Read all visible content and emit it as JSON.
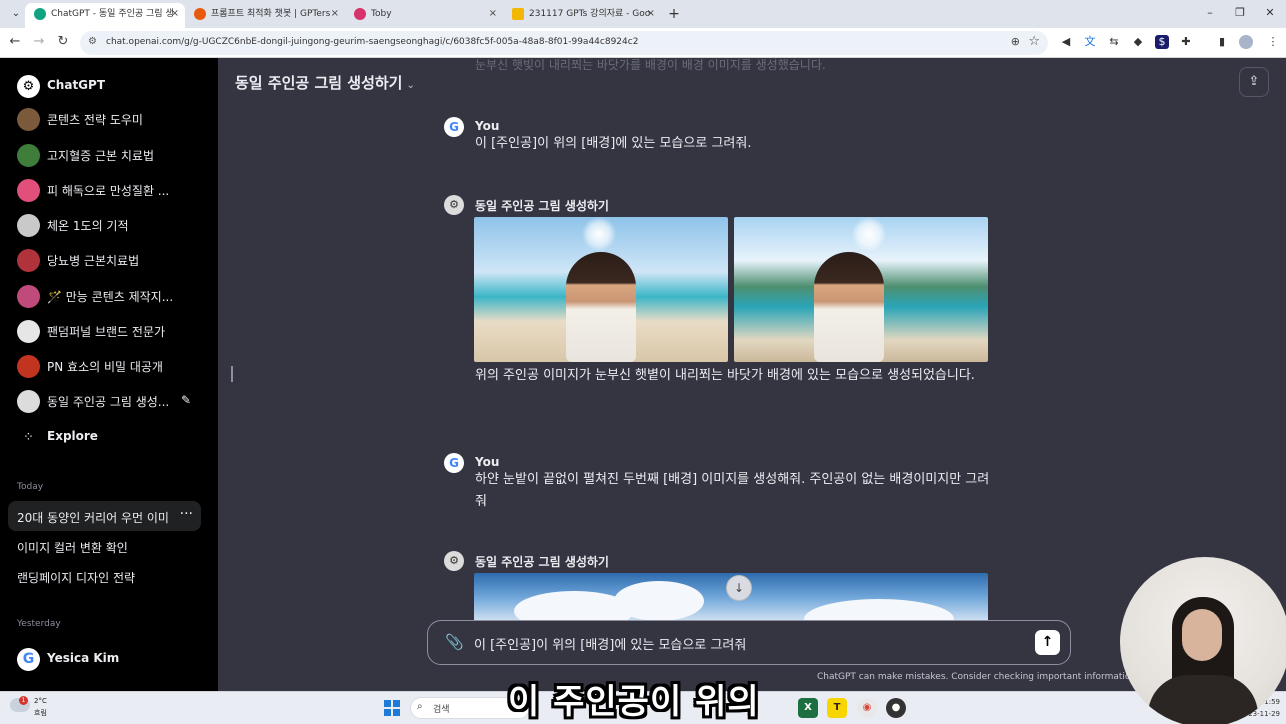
{
  "browser": {
    "tabs": [
      {
        "title": "ChatGPT - 동일 주인공 그림 생",
        "active": true,
        "favicon_color": "#10a37f"
      },
      {
        "title": "프롬프트 최적화 챗봇 | GPTers",
        "active": false,
        "favicon_color": "#e8590c"
      },
      {
        "title": "Toby",
        "active": false,
        "favicon_color": "#d6336c"
      },
      {
        "title": "231117 GPTs 강의자료 - Goo",
        "active": false,
        "favicon_color": "#f2b705"
      }
    ],
    "url": "chat.openai.com/g/g-UGCZC6nbE-dongil-juingong-geurim-saengseonghagi/c/6038fc5f-005a-48a8-8f01-99a44c8924c2"
  },
  "sidebar": {
    "brand": "ChatGPT",
    "gpts": [
      {
        "label": "콘텐츠 전략 도우미",
        "color": "#7a5a3a"
      },
      {
        "label": "고지혈증 근본 치료법",
        "color": "#3f7d3a"
      },
      {
        "label": "피 해독으로 만성질환 ...",
        "color": "#e0507a"
      },
      {
        "label": "체온 1도의 기적",
        "color": "#c9c9c9"
      },
      {
        "label": "당뇨병 근본치료법",
        "color": "#b0323a"
      },
      {
        "label": "🪄 만능 콘텐츠 제작지...",
        "color": "#c04a7a"
      },
      {
        "label": "팬덤퍼널 브랜드 전문가",
        "color": "#e6e6e6"
      },
      {
        "label": "PN 효소의 비밀 대공개",
        "color": "#c2341f"
      },
      {
        "label": "동일 주인공 그림 생성...",
        "color": "#dcdcdc"
      }
    ],
    "explore": "Explore",
    "sections": [
      {
        "title": "Today",
        "chats": [
          "20대 동양인 커리어 우먼 이미",
          "이미지 컬러 변환 확인",
          "랜딩페이지 디자인 전략"
        ]
      },
      {
        "title": "Yesterday",
        "chats": []
      }
    ],
    "user_name": "Yesica Kim"
  },
  "main": {
    "title": "동일 주인공 그림 생성하기",
    "ghost_text": "눈부신 햇빛이 내리쬐는 바닷가를 배경이 배경 이미지를 생성했습니다.",
    "messages": [
      {
        "author": "You",
        "text": "이 [주인공]이 위의 [배경]에 있는 모습으로 그려줘."
      },
      {
        "author": "동일 주인공 그림 생성하기",
        "text": "위의 주인공 이미지가 눈부신 햇볕이 내리쬐는 바닷가 배경에 있는 모습으로 생성되었습니다."
      },
      {
        "author": "You",
        "text": "하얀 눈밭이 끝없이 펼쳐진 두번째 [배경] 이미지를 생성해줘. 주인공이 없는 배경이미지만 그려줘"
      },
      {
        "author": "동일 주인공 그림 생성하기",
        "text": ""
      }
    ],
    "composer_value": "이 [주인공]이 위의 [배경]에 있는 모습으로 그려줘",
    "disclaimer": "ChatGPT can make mistakes. Consider checking important information."
  },
  "taskbar": {
    "weather_temp": "2°C",
    "weather_desc": "흐림",
    "weather_badge": "1",
    "search_placeholder": "검색",
    "time": "오후 1:59",
    "date": "2023-11-29"
  },
  "overlay": {
    "subtitle": "이 주인공이 위의"
  }
}
